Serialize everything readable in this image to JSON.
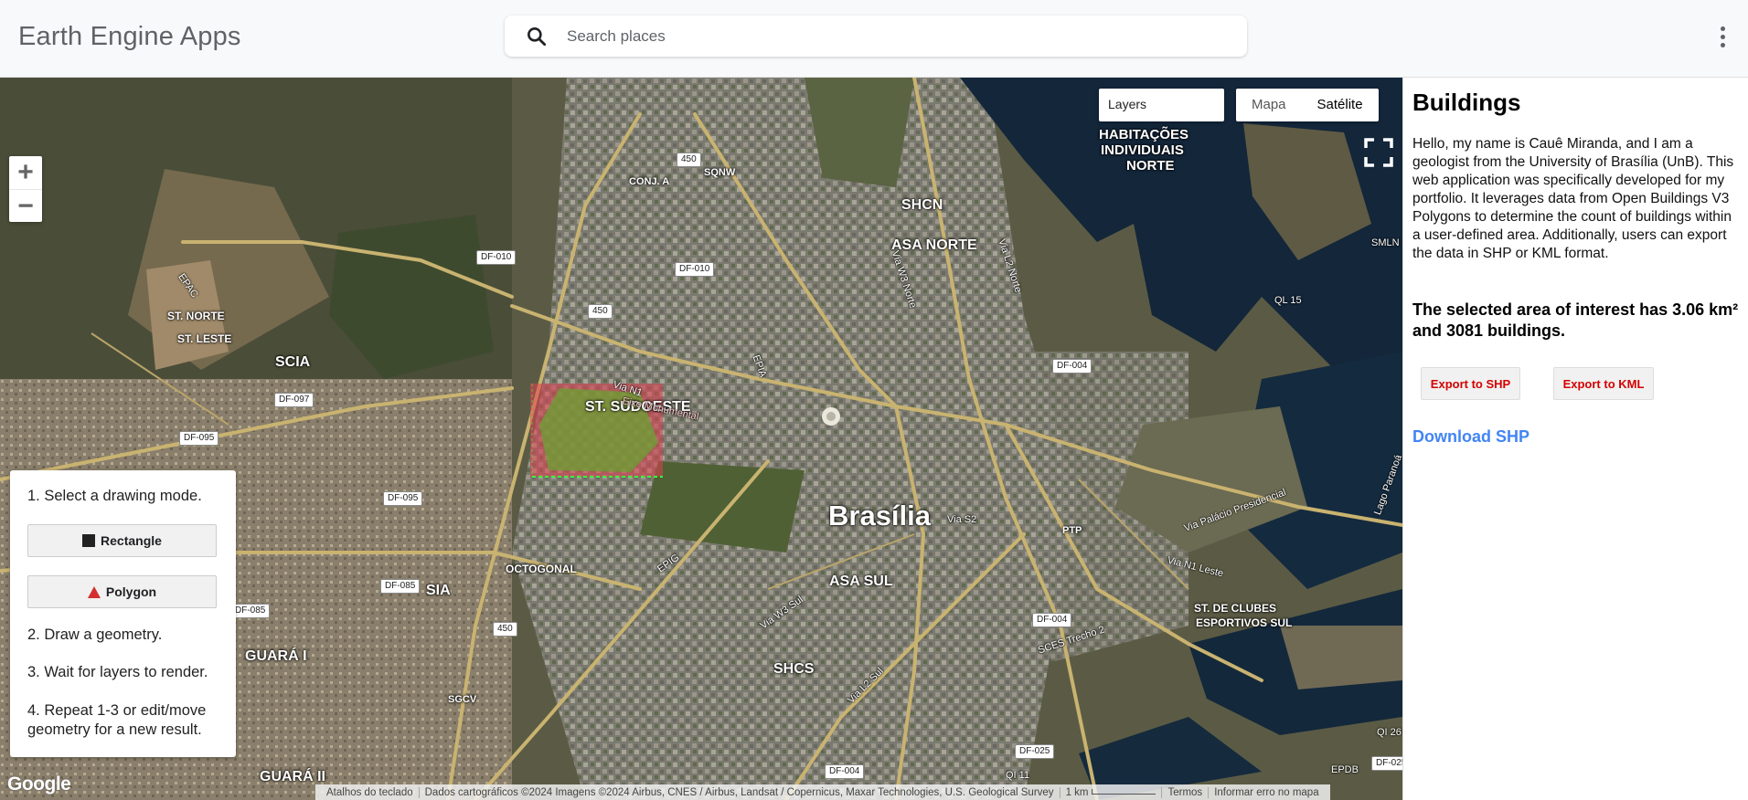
{
  "app": {
    "title": "Earth Engine Apps"
  },
  "search": {
    "placeholder": "Search places"
  },
  "map": {
    "layers_label": "Layers",
    "map_type_options": [
      "Mapa",
      "Satélite"
    ],
    "map_type_selected": "Satélite",
    "zoom_in": "+",
    "zoom_out": "−",
    "place_labels": {
      "brasilia": "Brasília",
      "asa_norte": "ASA NORTE",
      "asa_sul": "ASA SUL",
      "shcn": "SHCN",
      "shcs": "SHCS",
      "st_sudoeste": "ST. SUDOESTE",
      "scia": "SCIA",
      "sia": "SIA",
      "octogonal": "OCTOGONAL",
      "st_norte": "ST. NORTE",
      "st_leste": "ST. LESTE",
      "conj_a": "CONJ. A",
      "sqnw": "SQNW",
      "sgcv": "SGCV",
      "ptp": "PTP",
      "guara_i": "GUARÁ I",
      "guara_ii": "GUARÁ II",
      "habitacoes_1": "HABITAÇÕES",
      "habitacoes_2": "INDIVIDUAIS",
      "habitacoes_3": "NORTE",
      "st_clubes_1": "ST. DE CLUBES",
      "st_clubes_2": "ESPORTIVOS SUL",
      "epac": "EPAC",
      "epia": "EPIA",
      "epig": "EPIG",
      "eixo": "Eixo Monumental",
      "via_n1": "Via N1",
      "via_s2": "Via S2",
      "via_palacio": "Via Palácio Presidencial",
      "via_n1_leste": "Via N1 Leste",
      "lago": "Lago Paranoá",
      "smln": "SMLN",
      "ql15": "QL 15",
      "qi26": "QI 26",
      "qi11": "QI 11",
      "epdb": "EPDB",
      "ces": "SCES Trecho 2",
      "via_w3_sul": "Via W3 Sul",
      "via_l2_sul": "Via L2 Sul",
      "via_w3_norte": "Via W3 Norte",
      "via_l2_norte": "Via L2 Norte"
    },
    "shields": [
      "DF-010",
      "DF-010",
      "450",
      "450",
      "450",
      "DF-097",
      "DF-095",
      "DF-095",
      "DF-085",
      "DF-085",
      "DF-004",
      "DF-004",
      "DF-004",
      "DF-025",
      "DF-025"
    ],
    "logo": "Google",
    "attribution": {
      "shortcuts": "Atalhos do teclado",
      "data": "Dados cartográficos ©2024 Imagens ©2024 Airbus, CNES / Airbus, Landsat / Copernicus, Maxar Technologies, U.S. Geological Survey",
      "scale": "1 km",
      "terms": "Termos",
      "report": "Informar erro no mapa"
    }
  },
  "instructions": {
    "step1": "1. Select a drawing mode.",
    "rectangle_label": "Rectangle",
    "polygon_label": "Polygon",
    "step2": "2. Draw a geometry.",
    "step3": "3. Wait for layers to render.",
    "step4": "4. Repeat 1-3 or edit/move geometry for a new result."
  },
  "panel": {
    "title": "Buildings",
    "description": "Hello, my name is Cauê Miranda, and I am a geologist from the University of Brasília (UnB). This web application was specifically developed for my portfolio. It leverages data from Open Buildings V3 Polygons to determine the count of buildings within a user-defined area. Additionally, users can export the data in SHP or KML format.",
    "result": "The selected area of interest has 3.06 km² and 3081 buildings.",
    "export_shp": "Export to SHP",
    "export_kml": "Export to KML",
    "download_shp": "Download SHP"
  }
}
